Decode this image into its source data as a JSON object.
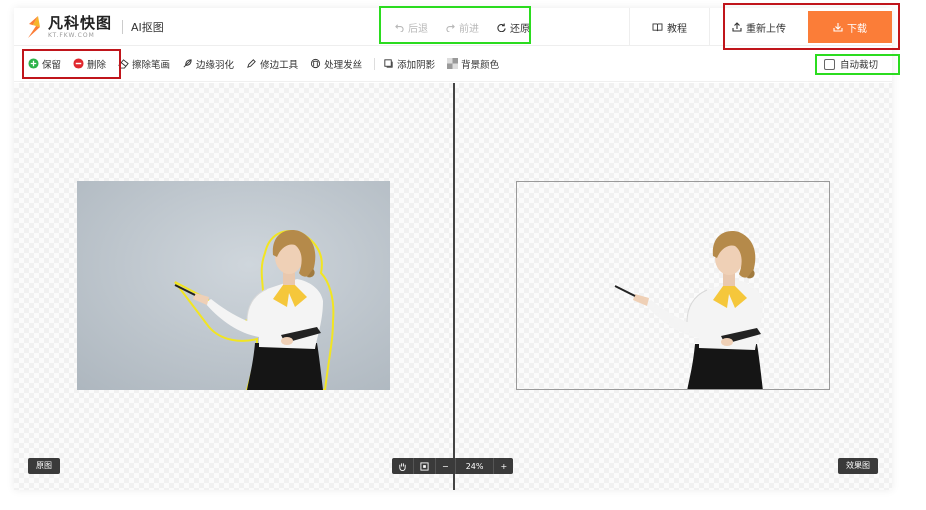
{
  "header": {
    "logo_name": "凡科快图",
    "logo_sub": "KT.FKW.COM",
    "app_title": "AI抠图",
    "history": [
      {
        "label": "后退",
        "icon": "undo-icon",
        "enabled": false
      },
      {
        "label": "前进",
        "icon": "redo-icon",
        "enabled": false
      },
      {
        "label": "还原",
        "icon": "restore-icon",
        "enabled": true
      }
    ],
    "tutorial_label": "教程",
    "reupload_label": "重新上传",
    "download_label": "下载"
  },
  "toolbar": {
    "keep_label": "保留",
    "delete_label": "删除",
    "tools": [
      {
        "label": "擦除笔画",
        "icon": "eraser-icon"
      },
      {
        "label": "边缘羽化",
        "icon": "feather-icon"
      },
      {
        "label": "修边工具",
        "icon": "pen-icon"
      },
      {
        "label": "处理发丝",
        "icon": "hair-icon"
      },
      {
        "label": "添加阴影",
        "icon": "shadow-icon"
      },
      {
        "label": "背景颜色",
        "icon": "bgcolor-icon"
      }
    ],
    "autocrop_label": "自动裁切",
    "autocrop_checked": false
  },
  "canvas": {
    "original_label": "原图",
    "result_label": "效果图",
    "zoom_value": "24%",
    "zoom_minus": "−",
    "zoom_plus": "+"
  },
  "colors": {
    "accent": "#fb7d38",
    "keep": "#2db34a",
    "delete": "#e0282e",
    "outline": "#f2e521",
    "annotation_red": "#c0151b",
    "annotation_green": "#2bdc1f"
  }
}
